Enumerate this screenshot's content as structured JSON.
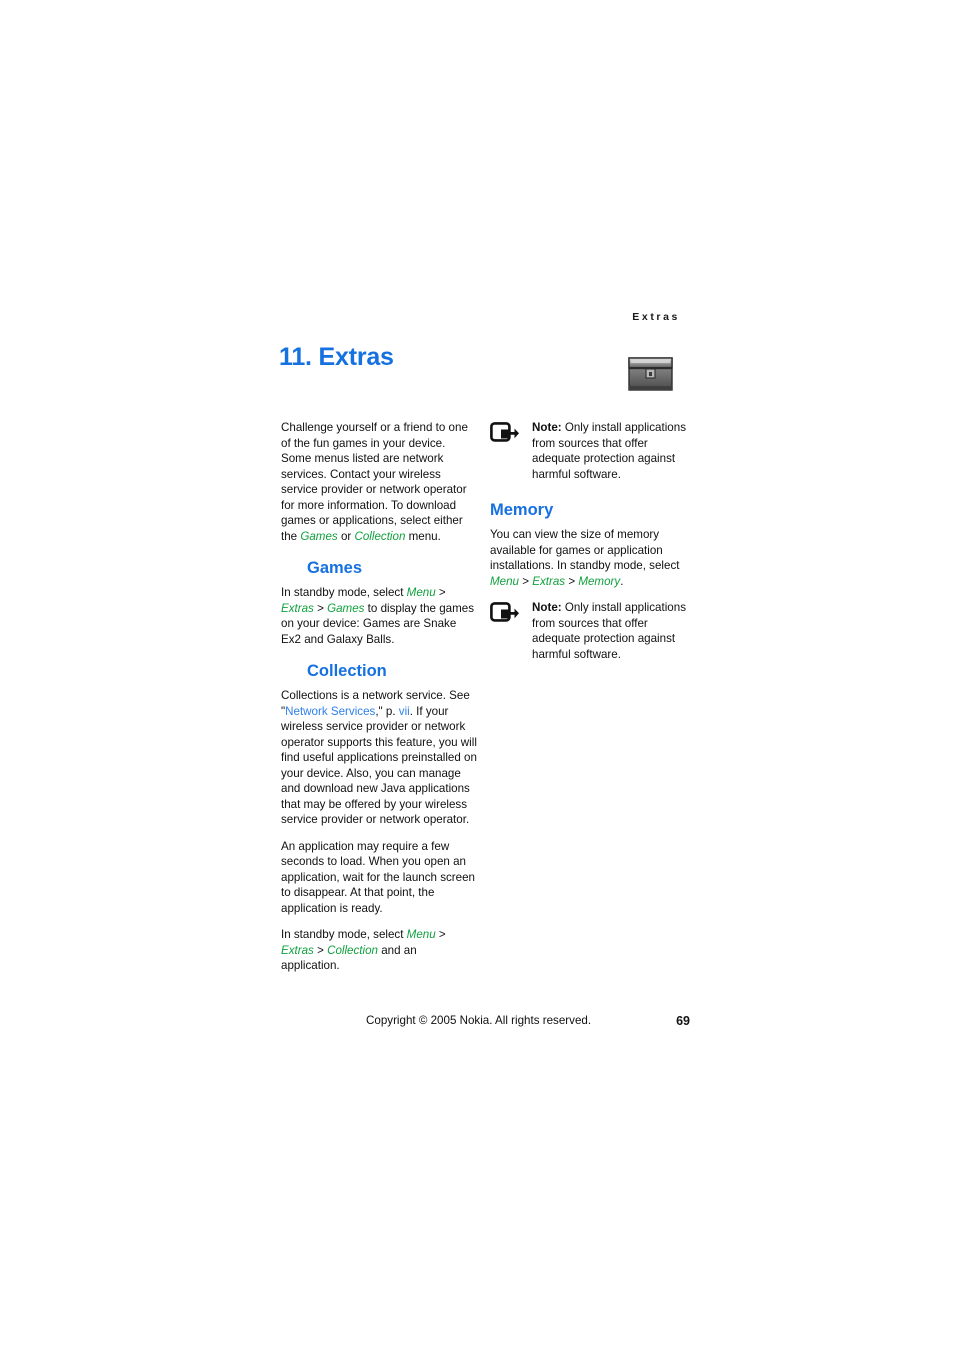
{
  "header": {
    "running_title": "Extras"
  },
  "chapter": {
    "number_title": "11. Extras",
    "icon": "treasure-chest-icon"
  },
  "colors": {
    "heading_blue": "#1570e0",
    "link_blue": "#2f80ea",
    "menu_green": "#11a13e",
    "body_black": "#111111"
  },
  "left_column": {
    "intro": {
      "part1": "Challenge yourself or a friend to one of the fun games in your device. Some menus listed are network services. Contact your wireless service provider or network operator for more information. To download games or applications, select either the ",
      "games_italic": "Games",
      "part2": " or ",
      "collection_italic": "Collection",
      "part3": " menu."
    },
    "games": {
      "heading": "Games",
      "text_part1": "In standby mode, select ",
      "menu": "Menu",
      "sep1": " > ",
      "extras": "Extras",
      "sep2": " > ",
      "games": "Games",
      "text_part2": " to display the games on your device: Games are Snake Ex2 and Galaxy Balls."
    },
    "collection": {
      "heading": "Collection",
      "para1_part1": "Collections is a network service. See \"",
      "link_network_services": "Network Services",
      "para1_part2": ",\" p. ",
      "link_page": "vii",
      "para1_part3": ". If your wireless service provider or network operator supports this feature, you will find useful applications preinstalled on your device. Also, you can manage and download new Java applications that may be offered by your wireless service provider or network operator.",
      "para2": "An application may require a few seconds to load. When you open an application, wait for the launch screen to disappear. At that point, the application is ready.",
      "para3_part1": "In standby mode, select ",
      "menu": "Menu",
      "sep1": " > ",
      "extras": "Extras",
      "sep2": " > ",
      "collection": "Collection",
      "para3_part2": " and an application."
    }
  },
  "right_column": {
    "note_top": {
      "label": "Note:",
      "text": " Only install applications from sources that offer adequate protection against harmful software."
    },
    "memory": {
      "heading": "Memory",
      "text_part1": "You can view the size of memory available for games or application installations. In standby mode, select ",
      "menu": "Menu",
      "sep1": " > ",
      "extras": "Extras",
      "sep2": " > ",
      "memory": "Memory",
      "text_part2": "."
    },
    "note_bottom": {
      "label": "Note:",
      "text": " Only install applications from sources that offer adequate protection against harmful software."
    }
  },
  "footer": {
    "copyright": "Copyright © 2005 Nokia. All rights reserved.",
    "page_number": "69"
  }
}
